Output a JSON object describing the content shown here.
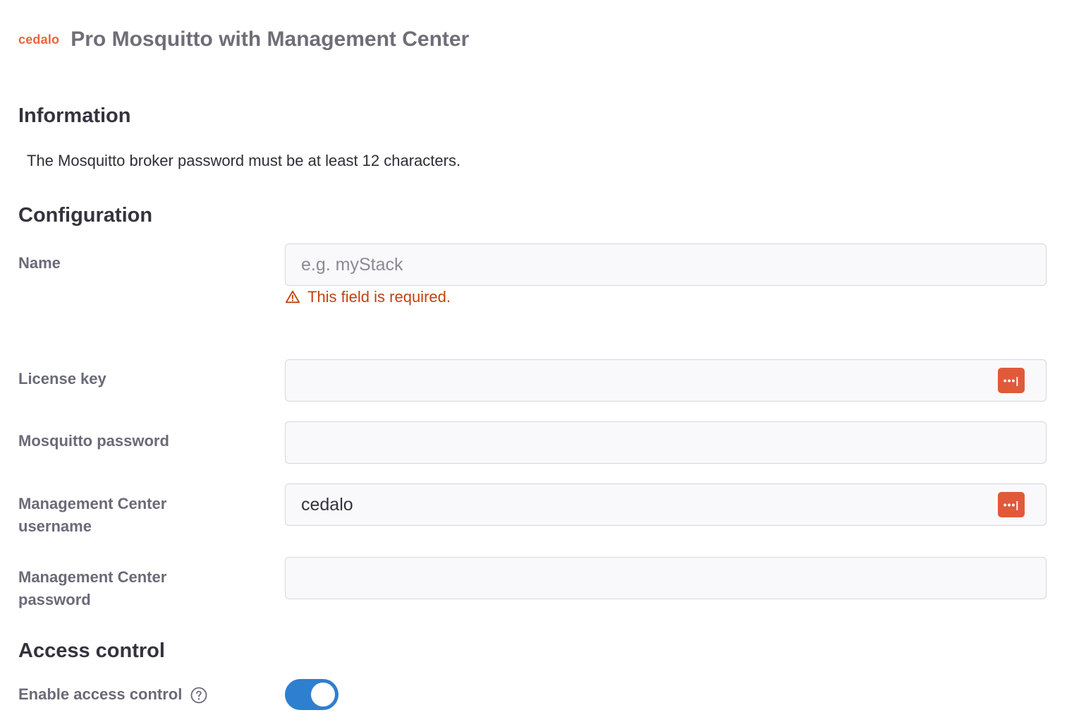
{
  "header": {
    "brand": "cedalo",
    "title": "Pro Mosquitto with Management Center"
  },
  "information": {
    "title": "Information",
    "text": "The Mosquitto broker password must be at least 12 characters."
  },
  "configuration": {
    "title": "Configuration",
    "name": {
      "label": "Name",
      "value": "",
      "placeholder": "e.g. myStack",
      "error": "This field is required."
    },
    "license_key": {
      "label": "License key",
      "value": "",
      "icon": "password-manager-icon"
    },
    "mosquitto_password": {
      "label": "Mosquitto password",
      "value": ""
    },
    "mc_username": {
      "label_line1": "Management Center",
      "label_line2": "username",
      "value": "cedalo",
      "icon": "password-manager-icon"
    },
    "mc_password": {
      "label_line1": "Management Center",
      "label_line2": "password",
      "value": ""
    }
  },
  "access_control": {
    "title": "Access control",
    "enable_label": "Enable access control",
    "enabled": true
  },
  "colors": {
    "brand": "#e8643e",
    "error": "#c0430f",
    "toggle_on": "#2f7fd0",
    "pm_icon": "#e05a3a"
  }
}
